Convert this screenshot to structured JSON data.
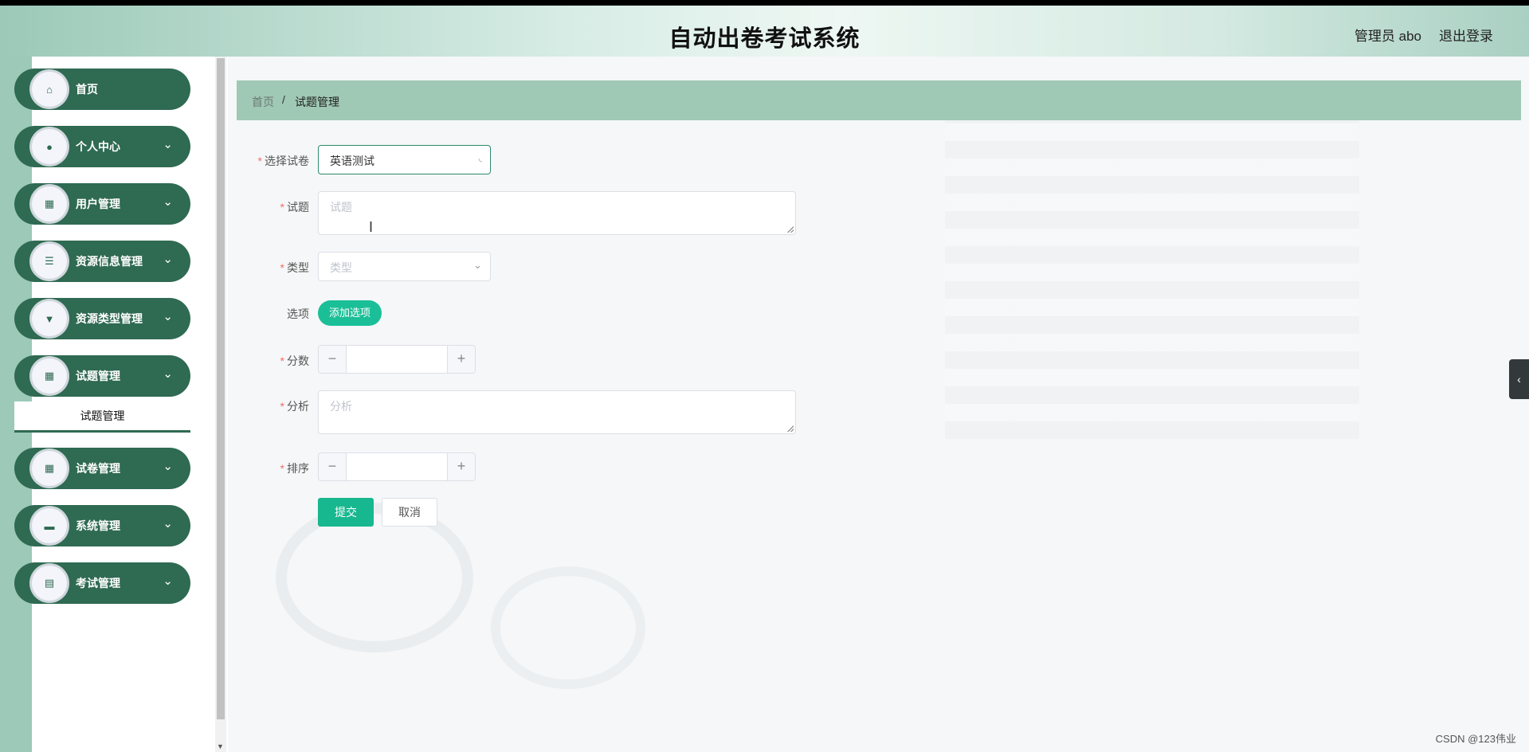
{
  "header": {
    "title": "自动出卷考试系统",
    "user": "管理员 abo",
    "logout": "退出登录"
  },
  "sidebar": {
    "items": [
      {
        "label": "首页",
        "icon": "home-icon",
        "glyph": "⌂",
        "has_arrow": false
      },
      {
        "label": "个人中心",
        "icon": "user-icon",
        "glyph": "●",
        "has_arrow": true
      },
      {
        "label": "用户管理",
        "icon": "grid-icon",
        "glyph": "▦",
        "has_arrow": true
      },
      {
        "label": "资源信息管理",
        "icon": "list-icon",
        "glyph": "☰",
        "has_arrow": true
      },
      {
        "label": "资源类型管理",
        "icon": "pin-icon",
        "glyph": "▼",
        "has_arrow": true
      },
      {
        "label": "试题管理",
        "icon": "grid-icon",
        "glyph": "▦",
        "has_arrow": true
      },
      {
        "label": "试卷管理",
        "icon": "grid-icon",
        "glyph": "▦",
        "has_arrow": true
      },
      {
        "label": "系统管理",
        "icon": "briefcase-icon",
        "glyph": "▬",
        "has_arrow": true
      },
      {
        "label": "考试管理",
        "icon": "clipboard-icon",
        "glyph": "▤",
        "has_arrow": true
      }
    ],
    "chevron": "⌄",
    "submenu_label": "试题管理"
  },
  "breadcrumb": {
    "home": "首页",
    "separator": "/",
    "current": "试题管理"
  },
  "form": {
    "paper_label": "选择试卷",
    "paper_value": "英语测试",
    "question_label": "试题",
    "question_placeholder": "试题",
    "type_label": "类型",
    "type_placeholder": "类型",
    "options_label": "选项",
    "add_option_button": "添加选项",
    "score_label": "分数",
    "analysis_label": "分析",
    "analysis_placeholder": "分析",
    "order_label": "排序",
    "required_mark": "*",
    "minus": "−",
    "plus": "+",
    "submit_button": "提交",
    "cancel_button": "取消"
  },
  "side_tab": "‹",
  "watermark": "CSDN @123伟业",
  "colors": {
    "sidebar_item": "#2f6a52",
    "accent": "#1bbf97",
    "breadcrumb_bg": "#9fc8b5",
    "required": "#f56c6c"
  }
}
